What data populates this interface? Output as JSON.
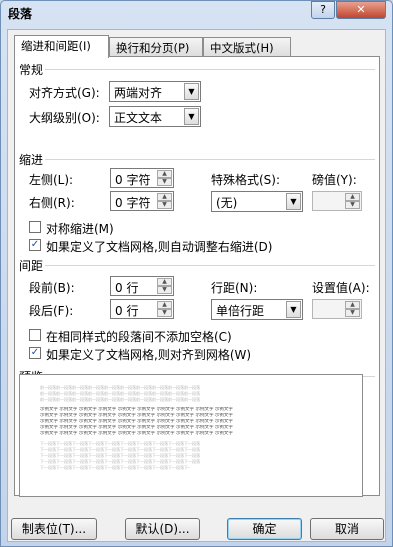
{
  "window": {
    "title": "段落",
    "help_label": "?",
    "close_label": "✕"
  },
  "tabs": [
    {
      "label": "缩进和间距(I)"
    },
    {
      "label": "换行和分页(P)"
    },
    {
      "label": "中文版式(H)"
    }
  ],
  "general": {
    "heading": "常规",
    "alignment_label": "对齐方式(G):",
    "alignment_value": "两端对齐",
    "outline_label": "大纲级别(O):",
    "outline_value": "正文文本"
  },
  "indent": {
    "heading": "缩进",
    "left_label": "左侧(L):",
    "left_value": "0 字符",
    "right_label": "右侧(R):",
    "right_value": "0 字符",
    "special_label": "特殊格式(S):",
    "special_value": "(无)",
    "by_label": "磅值(Y):",
    "by_value": "",
    "mirror_label": "对称缩进(M)",
    "mirror_checked": false,
    "auto_adjust_label": "如果定义了文档网格,则自动调整右缩进(D)",
    "auto_adjust_checked": true
  },
  "spacing": {
    "heading": "间距",
    "before_label": "段前(B):",
    "before_value": "0 行",
    "after_label": "段后(F):",
    "after_value": "0 行",
    "line_label": "行距(N):",
    "line_value": "单倍行距",
    "at_label": "设置值(A):",
    "at_value": "",
    "no_space_label": "在相同样式的段落间不添加空格(C)",
    "no_space_checked": false,
    "snap_grid_label": "如果定义了文档网格,则对齐到网格(W)",
    "snap_grid_checked": true
  },
  "preview": {
    "heading": "预览",
    "prev_text": "前一段落前一段落前一段落前一段落前一段落前一段落前一段落前一段落前一段落前一段落",
    "sample_text": "示例文字 示例文字 示例文字 示例文字 示例文字 示例文字 示例文字 示例文字 示例文字 示例文字",
    "next_text": "下一段落下一段落下一段落下一段落下一段落下一段落下一段落下一段落下一段落下一段落"
  },
  "buttons": {
    "tabs_label": "制表位(T)...",
    "default_label": "默认(D)...",
    "ok_label": "确定",
    "cancel_label": "取消"
  },
  "colors": {
    "accent": "#3c7fb1",
    "check": "#1e4f9c"
  }
}
